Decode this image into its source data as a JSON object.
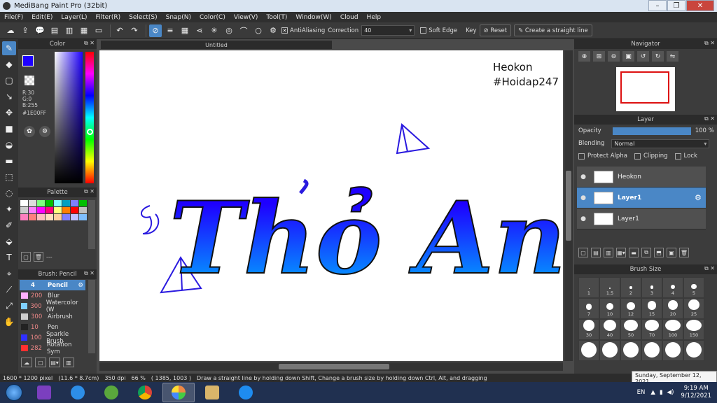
{
  "window": {
    "title": "MediBang Paint Pro (32bit)"
  },
  "menu": [
    "File(F)",
    "Edit(E)",
    "Layer(L)",
    "Filter(R)",
    "Select(S)",
    "Snap(N)",
    "Color(C)",
    "View(V)",
    "Tool(T)",
    "Window(W)",
    "Cloud",
    "Help"
  ],
  "toolbar": {
    "antialias_label": "AntiAliasing",
    "correction_label": "Correction",
    "correction_value": "40",
    "soft_edge_label": "Soft Edge",
    "key_label": "Key",
    "reset_label": "Reset",
    "straight_line_label": "Create a straight line"
  },
  "color_panel": {
    "title": "Color",
    "r": "R:30",
    "g": "G:0",
    "b": "B:255",
    "hex": "#1E00FF",
    "fg_color": "#1E00FF"
  },
  "palette": {
    "title": "Palette",
    "colors": [
      "#ffffff",
      "#dddddd",
      "#7fff7f",
      "#00c000",
      "#7fffff",
      "#00a0c0",
      "#7f7fff",
      "#00c000",
      "#cccccc",
      "#ff7fff",
      "#ff00ff",
      "#ff007f",
      "#ffff7f",
      "#ff7f00",
      "#ff0000",
      "#c0c0c0",
      "#ff7fbf",
      "#ff7f7f",
      "#ffbfbf",
      "#ffdfbf",
      "#ffcfa0",
      "#7f7fff",
      "#bfbfff",
      "#7fbfff"
    ],
    "footer_text": "---"
  },
  "brush": {
    "title": "Brush: Pencil",
    "items": [
      {
        "size": "4",
        "name": "Pencil",
        "color": "#4a87c6",
        "selected": true
      },
      {
        "size": "200",
        "name": "Blur",
        "color": "#ffb0ff"
      },
      {
        "size": "300",
        "name": "Watercolor (W",
        "color": "#7fd0ff"
      },
      {
        "size": "300",
        "name": "Airbrush",
        "color": "#cccccc"
      },
      {
        "size": "10",
        "name": "Pen",
        "color": "#222222"
      },
      {
        "size": "100",
        "name": "Sparkle Brush",
        "color": "#3030ff"
      },
      {
        "size": "282",
        "name": "Rotation Sym",
        "color": "#ff3030"
      }
    ]
  },
  "document": {
    "tab": "Untitled",
    "watermark_1": "Heokon",
    "watermark_2": "#Hoidap247"
  },
  "navigator": {
    "title": "Navigator"
  },
  "layer_panel": {
    "title": "Layer",
    "opacity_label": "Opacity",
    "opacity_value": "100 %",
    "opacity_fraction": 1.0,
    "blending_label": "Blending",
    "blending_value": "Normal",
    "protect_alpha_label": "Protect Alpha",
    "clipping_label": "Clipping",
    "lock_label": "Lock",
    "layers": [
      {
        "name": "Heokon",
        "selected": false
      },
      {
        "name": "Layer1",
        "selected": true
      },
      {
        "name": "Layer1",
        "selected": false
      }
    ]
  },
  "brush_size": {
    "title": "Brush Size",
    "sizes": [
      "1",
      "1.5",
      "2",
      "3",
      "4",
      "5",
      "7",
      "10",
      "12",
      "15",
      "20",
      "25",
      "30",
      "40",
      "50",
      "70",
      "100",
      "150",
      "",
      "",
      "",
      "",
      "",
      ""
    ]
  },
  "status": {
    "dimensions": "1600 * 1200 pixel",
    "cm": "(11.6 * 8.7cm)",
    "dpi": "350 dpi",
    "zoom": "66 %",
    "coords": "( 1385, 1003 )",
    "hint": "Draw a straight line by holding down Shift, Change a brush size by holding down Ctrl, Alt, and dragging"
  },
  "tooltip": "Sunday, September 12, 2021",
  "taskbar": {
    "lang": "EN",
    "time": "9:19 AM",
    "date": "9/12/2021"
  },
  "artwork": {
    "text": "Thỏ An",
    "ink": "#1E00FF",
    "gradient_end": "#00b4ff"
  }
}
